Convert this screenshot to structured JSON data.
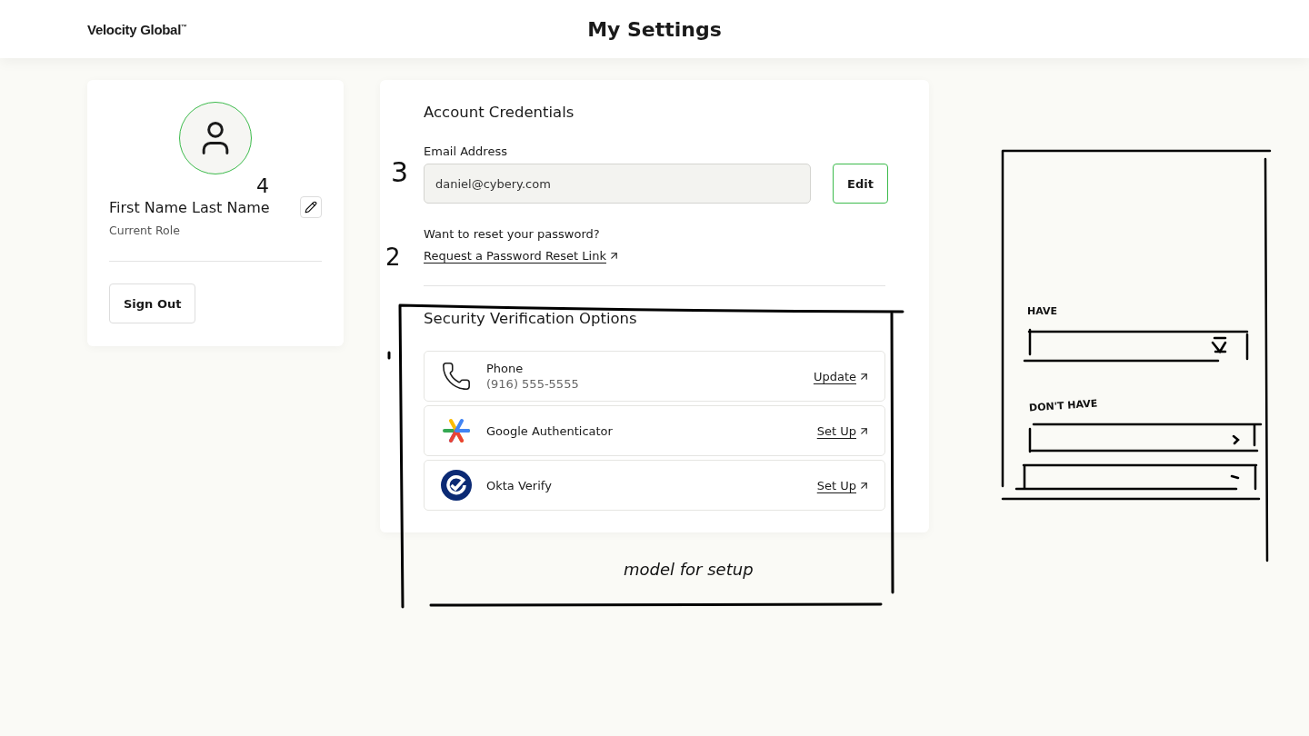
{
  "header": {
    "logo": "Velocity Global$^{™}$",
    "title": "My Settings"
  },
  "profile": {
    "name": "First Name Last Name",
    "role": "Current Role",
    "sign_out": "Sign Out"
  },
  "credentials": {
    "title": "Account Credentials",
    "email_label": "Email Address",
    "email_value": "daniel@cybery.com",
    "edit_button": "Edit",
    "reset_prompt": "Want to reset your password?",
    "reset_link": "Request a Password Reset Link"
  },
  "security": {
    "title": "Security Verification Options",
    "options": [
      {
        "kind": "phone",
        "name": "Phone",
        "detail": "(916) 555-5555",
        "action": "Update"
      },
      {
        "kind": "google",
        "name": "Google Authenticator",
        "action": "Set Up"
      },
      {
        "kind": "okta",
        "name": "Okta Verify",
        "action": "Set Up"
      }
    ]
  },
  "annotations": [
    {
      "kind": "number",
      "text": "4"
    },
    {
      "kind": "number",
      "text": "3"
    },
    {
      "kind": "number",
      "text": "2"
    },
    {
      "kind": "note",
      "text": "model for setup"
    },
    {
      "kind": "label",
      "text": "HAVE"
    },
    {
      "kind": "label",
      "text": "DON'T HAVE"
    }
  ]
}
